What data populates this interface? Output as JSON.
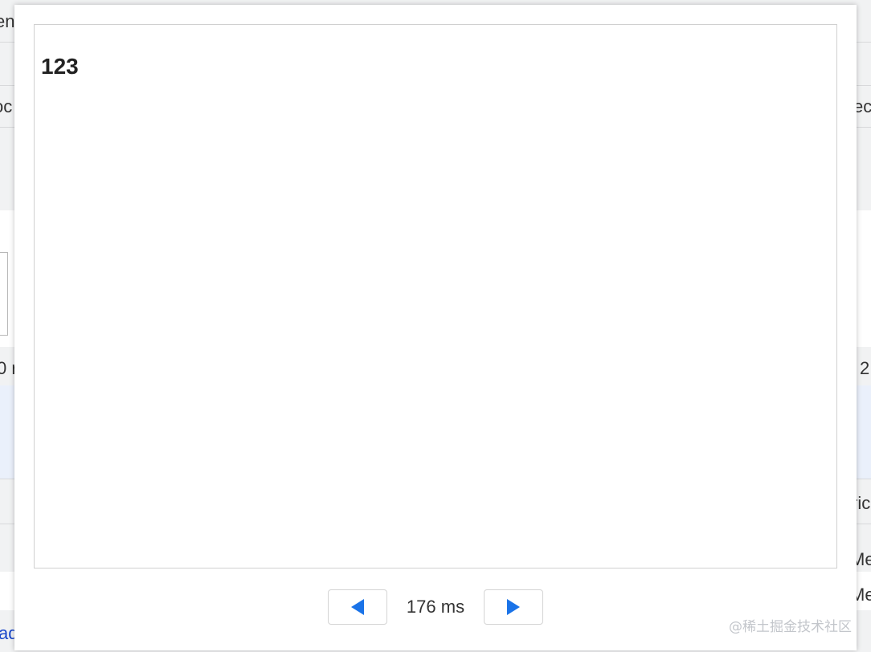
{
  "background": {
    "fragments": [
      {
        "id": "bg-frag-1",
        "text": "en"
      },
      {
        "id": "bg-frag-2",
        "text": "oc"
      },
      {
        "id": "bg-frag-3",
        "text": "ec"
      },
      {
        "id": "bg-frag-4",
        "text": "0 r"
      },
      {
        "id": "bg-frag-5",
        "text": "2"
      },
      {
        "id": "bg-frag-6",
        "text": "ric"
      },
      {
        "id": "bg-frag-7",
        "text": "Me"
      },
      {
        "id": "bg-frag-8",
        "text": "Me"
      },
      {
        "id": "bg-frag-9",
        "text": "ad"
      }
    ]
  },
  "viewer": {
    "frame_content": "123",
    "timing_label": "176 ms",
    "prev_icon": "triangle-left-icon",
    "next_icon": "triangle-right-icon",
    "accent_color": "#1a73e8"
  },
  "watermark": "@稀土掘金技术社区"
}
